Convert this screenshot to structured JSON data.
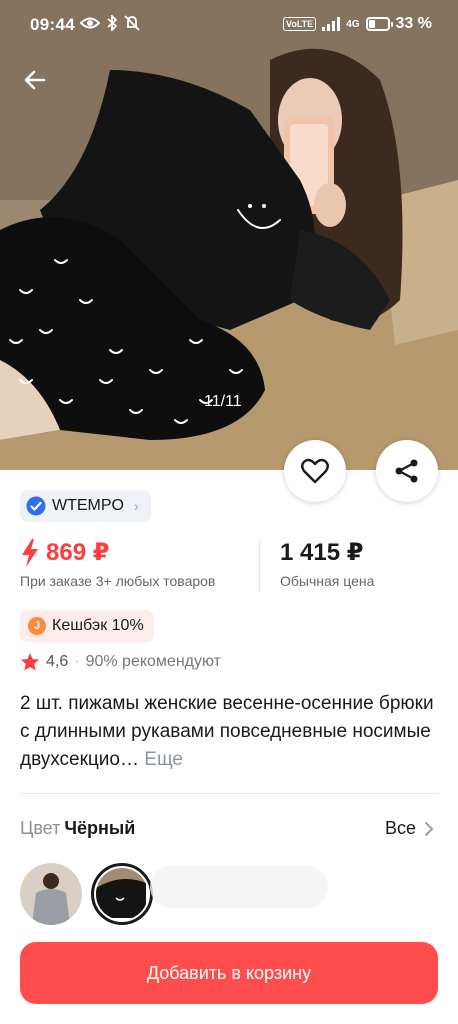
{
  "status_bar": {
    "time": "09:44",
    "volte": "VoLTE",
    "network": "4G",
    "battery": "33 %",
    "battery_level": 0.33,
    "left_icons": [
      "eye-icon",
      "bluetooth-icon",
      "mute-icon"
    ]
  },
  "gallery": {
    "counter": "11/11",
    "current": 11,
    "total": 11
  },
  "seller": {
    "name": "WTEMPO",
    "verified_color": "#2e6ff2"
  },
  "price": {
    "current": "869 ₽",
    "current_note": "При заказе 3+ любых товаров",
    "regular": "1 415 ₽",
    "regular_note": "Обычная цена",
    "accent_color": "#ff3b3b"
  },
  "cashback": {
    "label": "Кешбэк 10%"
  },
  "rating": {
    "score": "4,6",
    "separator": "·",
    "recommend": "90% рекомендуют"
  },
  "product": {
    "title": "2 шт. пижамы женские весенне-осенние брюки с длинными рукавами повседневные носимые двухсекцио…",
    "more": "Еще"
  },
  "variant": {
    "label": "Цвет",
    "value": "Чёрный",
    "all_label": "Все"
  },
  "cart": {
    "button_label": "Добавить в корзину",
    "button_color": "#ff4d4d"
  }
}
